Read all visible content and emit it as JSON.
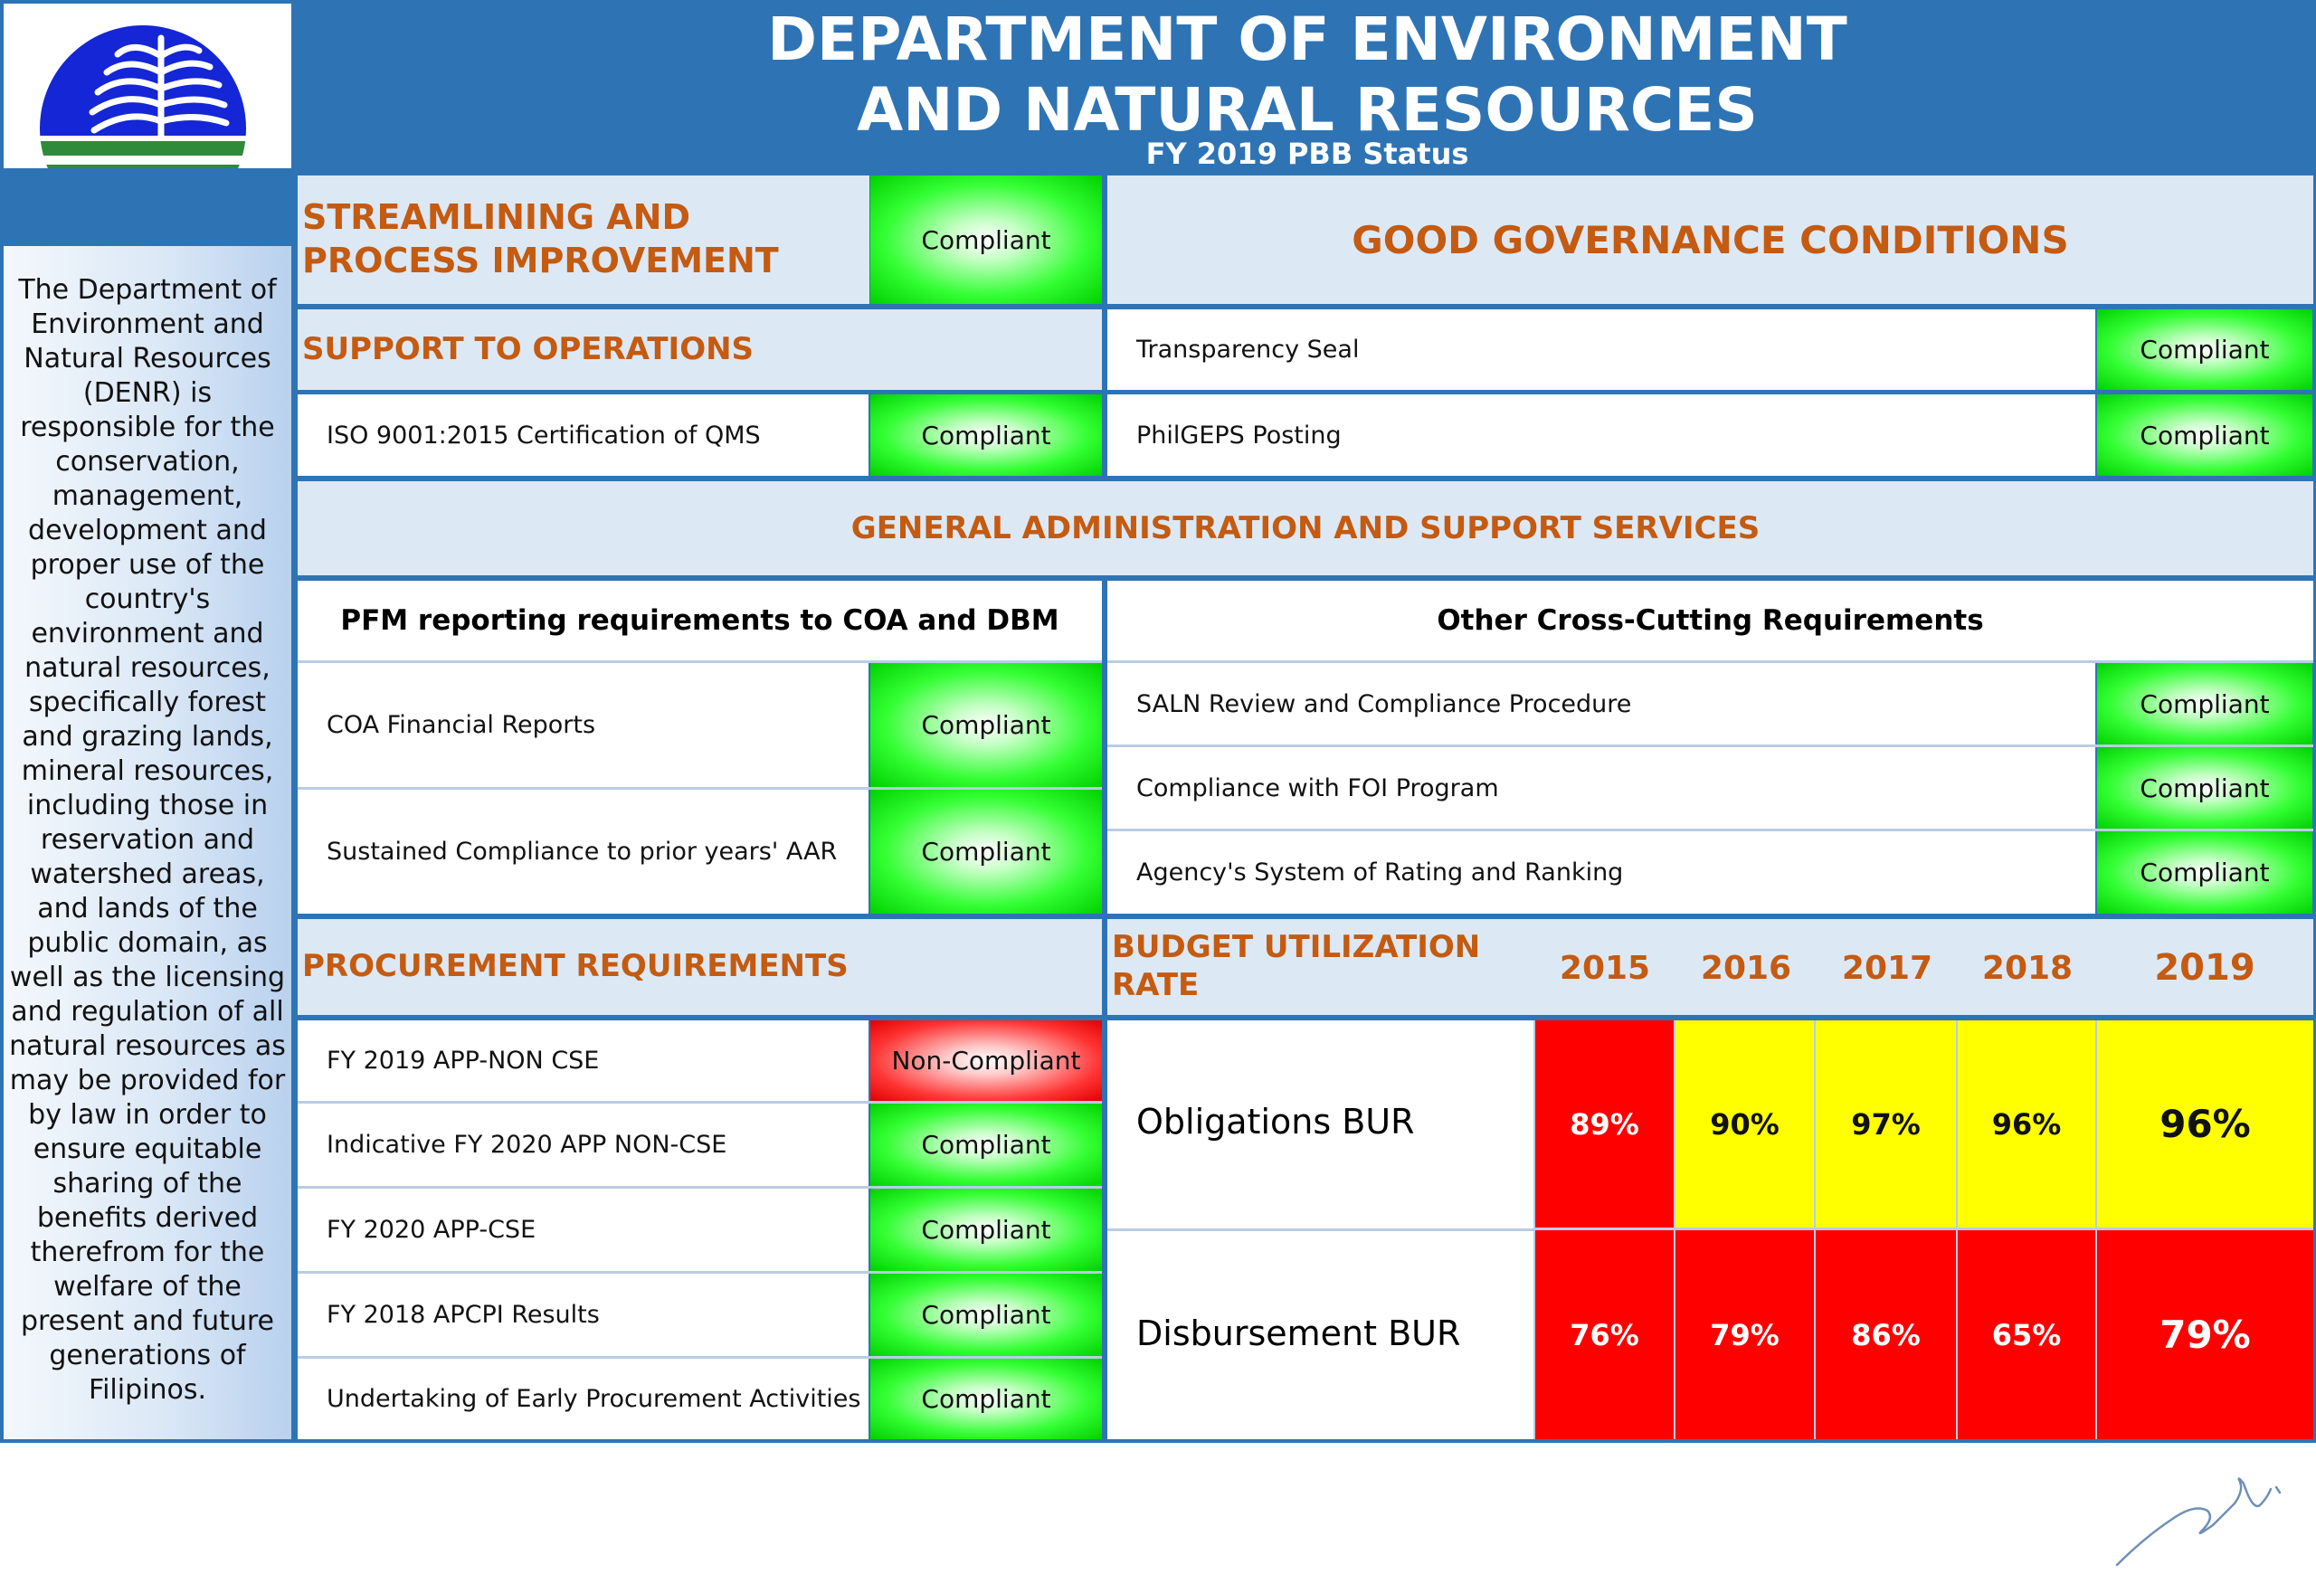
{
  "header": {
    "title_line1": "DEPARTMENT OF ENVIRONMENT",
    "title_line2": "AND NATURAL RESOURCES",
    "subtitle": "FY 2019 PBB Status"
  },
  "logo": {
    "icon": "denr-logo-icon"
  },
  "sidebar": {
    "description": "The Department of Environment and Natural Resources (DENR) is responsible for the conservation, management, development and proper use of the country's environment and natural resources, specifically forest and grazing lands, mineral resources, including those in reservation and watershed areas, and lands of the public domain, as well as the licensing and regulation of all natural resources as may be provided for by law in order to ensure equitable sharing of the benefits derived therefrom for the welfare of the present and future generations of Filipinos."
  },
  "streamlining": {
    "title": "STREAMLINING AND PROCESS IMPROVEMENT",
    "status": "Compliant"
  },
  "good_governance": {
    "title": "GOOD GOVERNANCE CONDITIONS",
    "items": [
      {
        "label": "Transparency Seal",
        "status": "Compliant"
      },
      {
        "label": "PhilGEPS Posting",
        "status": "Compliant"
      }
    ]
  },
  "support_operations": {
    "title": "SUPPORT TO OPERATIONS",
    "items": [
      {
        "label": "ISO 9001:2015 Certification of QMS",
        "status": "Compliant"
      }
    ]
  },
  "general_admin": {
    "title": "GENERAL ADMINISTRATION AND SUPPORT SERVICES"
  },
  "pfm": {
    "title": "PFM reporting requirements to COA and DBM",
    "items": [
      {
        "label": "COA Financial Reports",
        "status": "Compliant"
      },
      {
        "label": "Sustained Compliance to prior years' AAR",
        "status": "Compliant"
      }
    ]
  },
  "cross_cutting": {
    "title": "Other Cross-Cutting Requirements",
    "items": [
      {
        "label": "SALN  Review and Compliance Procedure",
        "status": "Compliant"
      },
      {
        "label": "Compliance with FOI Program",
        "status": "Compliant"
      },
      {
        "label": "Agency's System of Rating and Ranking",
        "status": "Compliant"
      }
    ]
  },
  "procurement": {
    "title": "PROCUREMENT REQUIREMENTS",
    "items": [
      {
        "label": "FY 2019 APP-NON CSE",
        "status": "Non-Compliant"
      },
      {
        "label": "Indicative FY 2020 APP NON-CSE",
        "status": "Compliant"
      },
      {
        "label": "FY 2020 APP-CSE",
        "status": "Compliant"
      },
      {
        "label": "FY 2018 APCPI Results",
        "status": "Compliant"
      },
      {
        "label": "Undertaking of Early Procurement Activities",
        "status": "Compliant"
      }
    ]
  },
  "budget": {
    "title": "BUDGET UTILIZATION RATE",
    "years": [
      "2015",
      "2016",
      "2017",
      "2018",
      "2019"
    ],
    "rows": [
      {
        "label": "Obligations BUR",
        "values": [
          "89%",
          "90%",
          "97%",
          "96%",
          "96%"
        ],
        "colors": [
          "#ff0000",
          "#ffff00",
          "#ffff00",
          "#ffff00",
          "#ffff00"
        ]
      },
      {
        "label": "Disbursement BUR",
        "values": [
          "76%",
          "79%",
          "86%",
          "65%",
          "79%"
        ],
        "colors": [
          "#ff0000",
          "#ff0000",
          "#ff0000",
          "#ff0000",
          "#ff0000"
        ]
      }
    ]
  },
  "colors": {
    "header_blue": "#2e74b5",
    "accent_orange": "#c55a11",
    "pale_blue": "#dce9f5",
    "compliant_green": "#00ff00",
    "non_compliant_red": "#ff0000",
    "bur_yellow": "#ffff00"
  }
}
